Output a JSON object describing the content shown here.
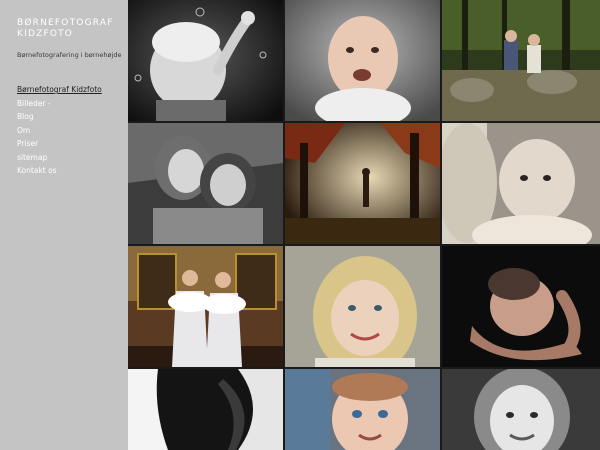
{
  "site": {
    "title": "Børnefotograf Kidzfoto",
    "tagline": "Børnefotografering i børnehøjde"
  },
  "nav": {
    "items": [
      {
        "label": "Børnefotograf Kidzfoto",
        "active": true
      },
      {
        "label": "Billeder -",
        "active": false
      },
      {
        "label": "Blog",
        "active": false
      },
      {
        "label": "Om",
        "active": false
      },
      {
        "label": "Priser",
        "active": false
      },
      {
        "label": "sitemap",
        "active": false
      },
      {
        "label": "Kontakt os",
        "active": false
      }
    ]
  },
  "gallery": {
    "photos": [
      {
        "name": "photo-child-bubbles"
      },
      {
        "name": "photo-laughing-baby"
      },
      {
        "name": "photo-couple-forest"
      },
      {
        "name": "photo-two-sisters"
      },
      {
        "name": "photo-autumn-forest-boy"
      },
      {
        "name": "photo-baby-on-shoulder"
      },
      {
        "name": "photo-twin-girls-fur"
      },
      {
        "name": "photo-blonde-girl"
      },
      {
        "name": "photo-newborn-hands"
      },
      {
        "name": "photo-pregnant-belly"
      },
      {
        "name": "photo-blue-eyed-baby"
      },
      {
        "name": "photo-girl-portrait"
      }
    ]
  },
  "colors": {
    "sidebar_bg": "#c4c4c4",
    "title_text": "#ffffff",
    "active_nav": "#222222"
  }
}
